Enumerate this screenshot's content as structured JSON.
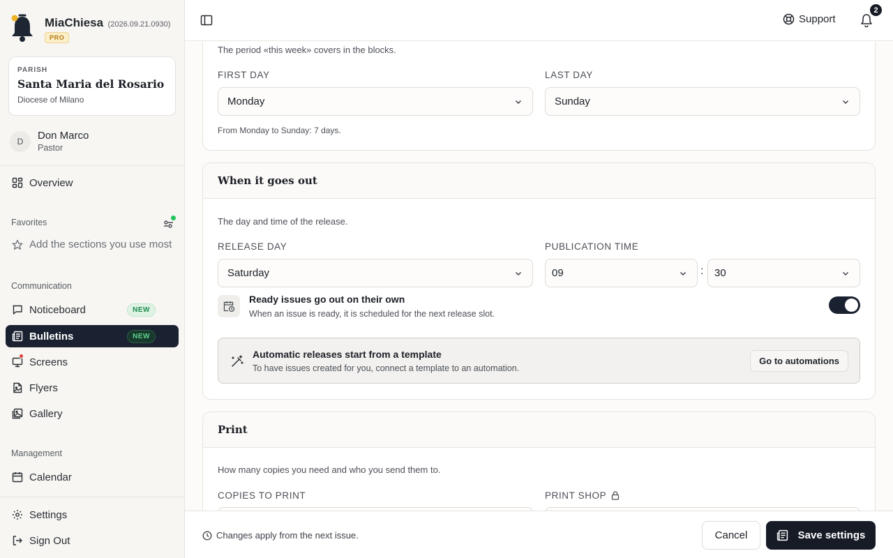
{
  "brand": {
    "name": "MiaChiesa",
    "version": "(2026.09.21.0930)",
    "tier": "PRO"
  },
  "parish": {
    "kicker": "PARISH",
    "name": "Santa Maria del Rosario",
    "diocese": "Diocese of Milano"
  },
  "user": {
    "initial": "D",
    "name": "Don Marco",
    "role": "Pastor"
  },
  "nav": {
    "overview": "Overview",
    "favorites_label": "Favorites",
    "favorites_add": "Add the sections you use most",
    "communication_label": "Communication",
    "communication": [
      {
        "label": "Noticeboard",
        "badge": "NEW"
      },
      {
        "label": "Bulletins",
        "badge": "NEW"
      },
      {
        "label": "Screens"
      },
      {
        "label": "Flyers"
      },
      {
        "label": "Gallery"
      }
    ],
    "management_label": "Management",
    "calendar": "Calendar",
    "settings": "Settings",
    "sign_out": "Sign Out"
  },
  "topbar": {
    "support": "Support",
    "notifications_count": "2"
  },
  "week_section": {
    "description": "The period «this week» covers in the blocks.",
    "first_day_label": "FIRST DAY",
    "first_day_value": "Monday",
    "last_day_label": "LAST DAY",
    "last_day_value": "Sunday",
    "summary": "From Monday to Sunday: 7 days."
  },
  "release_section": {
    "title": "When it goes out",
    "description": "The day and time of the release.",
    "release_day_label": "RELEASE DAY",
    "release_day_value": "Saturday",
    "publication_time_label": "PUBLICATION TIME",
    "hour": "09",
    "separator": ":",
    "minute": "30",
    "auto_title": "Ready issues go out on their own",
    "auto_desc": "When an issue is ready, it is scheduled for the next release slot.",
    "auto_enabled": true,
    "template_title": "Automatic releases start from a template",
    "template_desc": "To have issues created for you, connect a template to an automation.",
    "template_button": "Go to automations"
  },
  "print_section": {
    "title": "Print",
    "description": "How many copies you need and who you send them to.",
    "copies_label": "COPIES TO PRINT",
    "print_shop_label": "PRINT SHOP"
  },
  "footer": {
    "note": "Changes apply from the next issue.",
    "cancel": "Cancel",
    "save": "Save settings"
  },
  "colors": {
    "accent_dark": "#1a2231",
    "new_badge": "#1e8b4d",
    "alert_red": "#e23b3b",
    "online_green": "#22c55e"
  }
}
